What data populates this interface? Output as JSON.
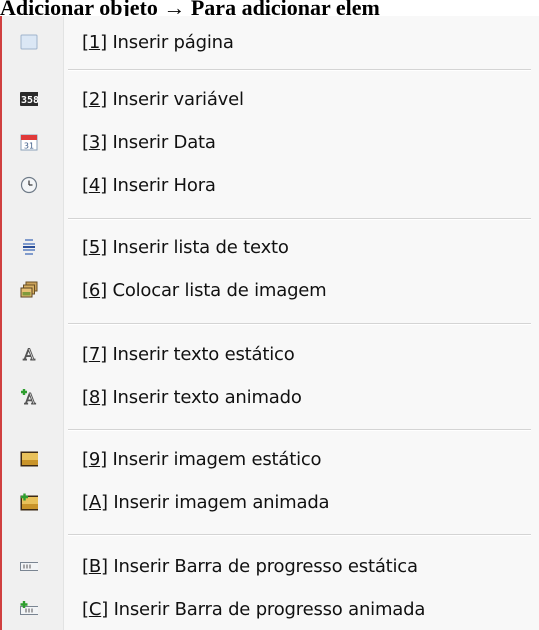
{
  "title": "Adicionar objeto → Para adicionar elem",
  "menu": {
    "items": [
      {
        "key": "1",
        "label": "Inserir página",
        "icon": "page-icon"
      },
      {
        "key": "2",
        "label": "Inserir variável",
        "icon": "variable-icon"
      },
      {
        "key": "3",
        "label": "Inserir Data",
        "icon": "calendar-icon"
      },
      {
        "key": "4",
        "label": "Inserir Hora",
        "icon": "clock-icon"
      },
      {
        "key": "5",
        "label": "Inserir lista de texto",
        "icon": "text-list-icon"
      },
      {
        "key": "6",
        "label": "Colocar lista de imagem",
        "icon": "image-list-icon"
      },
      {
        "key": "7",
        "label": "Inserir texto estático",
        "icon": "static-text-icon"
      },
      {
        "key": "8",
        "label": "Inserir texto animado",
        "icon": "animated-text-icon"
      },
      {
        "key": "9",
        "label": "Inserir imagem estático",
        "icon": "static-image-icon"
      },
      {
        "key": "A",
        "label": "Inserir imagem animada",
        "icon": "animated-image-icon"
      },
      {
        "key": "B",
        "label": "Inserir Barra de progresso estática",
        "icon": "static-progress-bar-icon"
      },
      {
        "key": "C",
        "label": "Inserir Barra de progresso animada",
        "icon": "animated-progress-bar-icon"
      }
    ]
  }
}
